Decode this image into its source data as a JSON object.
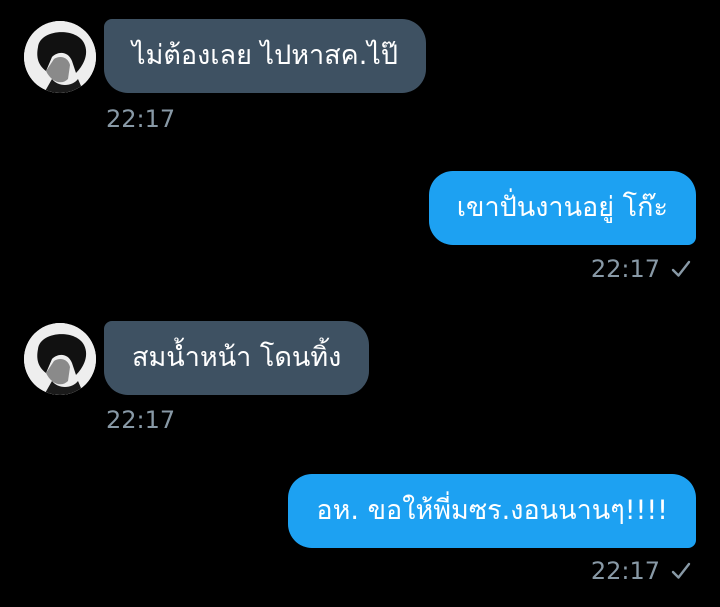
{
  "messages": [
    {
      "direction": "incoming",
      "text": "ไม่ต้องเลย ไปหาสค.ไป๊",
      "time": "22:17"
    },
    {
      "direction": "outgoing",
      "text": "เขาปั่นงานอยู่ โก๊ะ",
      "time": "22:17",
      "status_icon": "checkmark-icon"
    },
    {
      "direction": "incoming",
      "text": "สมน้ำหน้า โดนทิ้ง",
      "time": "22:17"
    },
    {
      "direction": "outgoing",
      "text": "อห. ขอให้พี่มซร.งอนนานๆ!!!!",
      "time": "22:17",
      "status_icon": "checkmark-icon"
    }
  ],
  "colors": {
    "background": "#000000",
    "incoming_bubble": "#3e5162",
    "outgoing_bubble": "#1da1f2",
    "timestamp": "#8899a6"
  }
}
